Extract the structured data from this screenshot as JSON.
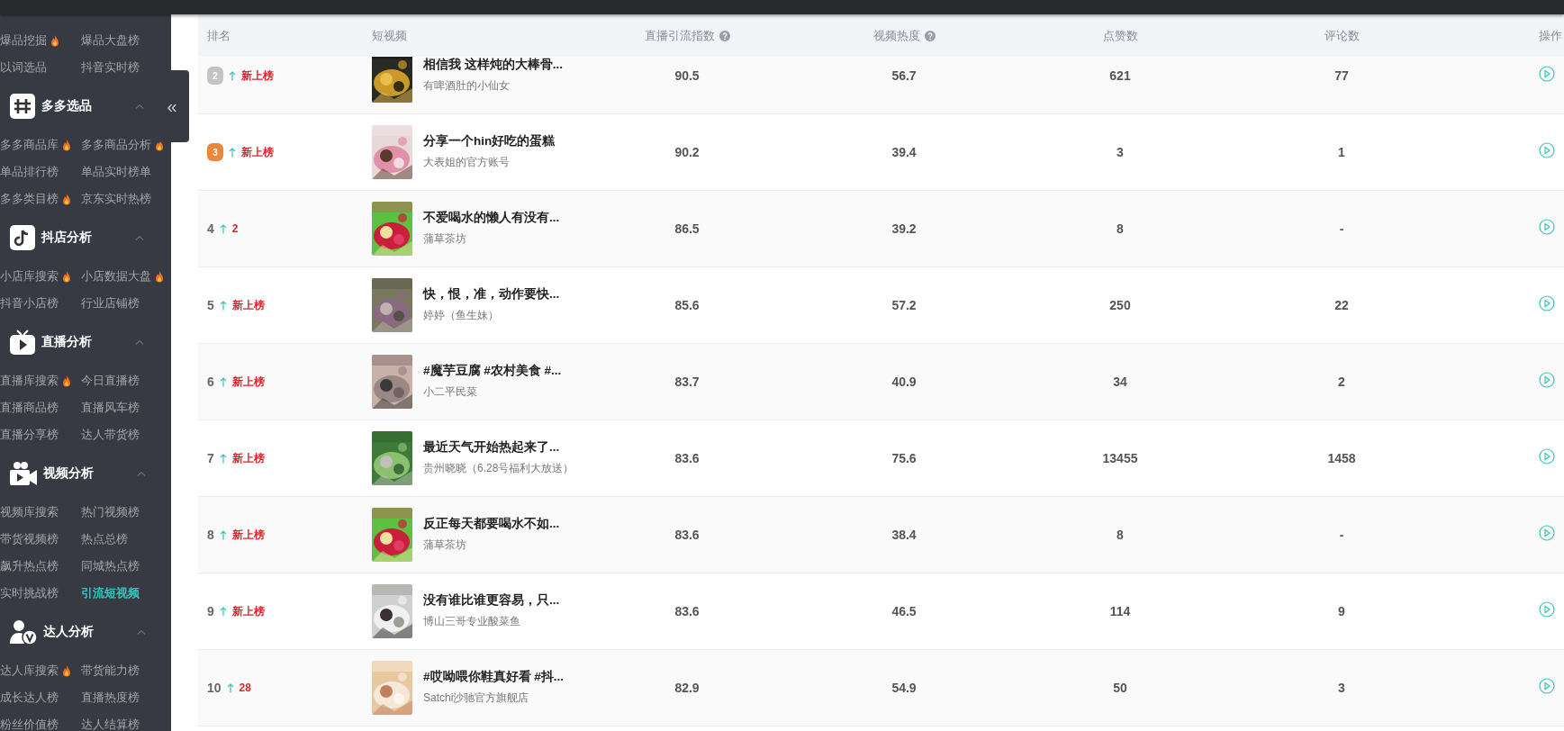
{
  "sidebar": {
    "groups": [
      {
        "items": [
          [
            {
              "label": "爆品挖掘",
              "hot": true,
              "selected": false
            },
            {
              "label": "爆品大盘榜",
              "hot": false,
              "selected": false
            }
          ],
          [
            {
              "label": "以词选品",
              "hot": false,
              "selected": false
            },
            {
              "label": "抖音实时榜",
              "hot": false,
              "selected": false
            }
          ]
        ]
      },
      {
        "title": "多多选品",
        "kind": "grid",
        "expanded": true,
        "items": [
          [
            {
              "label": "多多商品库",
              "hot": true,
              "selected": false
            },
            {
              "label": "多多商品分析",
              "hot": true,
              "selected": false
            }
          ],
          [
            {
              "label": "单品排行榜",
              "hot": false,
              "selected": false
            },
            {
              "label": "单品实时榜单",
              "hot": false,
              "selected": false
            }
          ],
          [
            {
              "label": "多多类目榜",
              "hot": true,
              "selected": false
            },
            {
              "label": "京东实时热榜",
              "hot": false,
              "selected": false
            }
          ]
        ]
      },
      {
        "title": "抖店分析",
        "kind": "note",
        "expanded": true,
        "items": [
          [
            {
              "label": "小店库搜索",
              "hot": true,
              "selected": false
            },
            {
              "label": "小店数据大盘",
              "hot": true,
              "selected": false
            }
          ],
          [
            {
              "label": "抖音小店榜",
              "hot": false,
              "selected": false
            },
            {
              "label": "行业店铺榜",
              "hot": false,
              "selected": false
            }
          ]
        ]
      },
      {
        "title": "直播分析",
        "kind": "tv",
        "expanded": true,
        "items": [
          [
            {
              "label": "直播库搜索",
              "hot": true,
              "selected": false
            },
            {
              "label": "今日直播榜",
              "hot": false,
              "selected": false
            }
          ],
          [
            {
              "label": "直播商品榜",
              "hot": false,
              "selected": false
            },
            {
              "label": "直播风车榜",
              "hot": false,
              "selected": false
            }
          ],
          [
            {
              "label": "直播分享榜",
              "hot": false,
              "selected": false
            },
            {
              "label": "达人带货榜",
              "hot": false,
              "selected": false
            }
          ]
        ]
      },
      {
        "title": "视频分析",
        "kind": "camera",
        "expanded": true,
        "items": [
          [
            {
              "label": "视频库搜索",
              "hot": false,
              "selected": false
            },
            {
              "label": "热门视频榜",
              "hot": false,
              "selected": false
            }
          ],
          [
            {
              "label": "带货视频榜",
              "hot": false,
              "selected": false
            },
            {
              "label": "热点总榜",
              "hot": false,
              "selected": false
            }
          ],
          [
            {
              "label": "飙升热点榜",
              "hot": false,
              "selected": false
            },
            {
              "label": "同城热点榜",
              "hot": false,
              "selected": false
            }
          ],
          [
            {
              "label": "实时挑战榜",
              "hot": false,
              "selected": false
            },
            {
              "label": "引流短视频",
              "hot": false,
              "selected": true
            }
          ]
        ]
      },
      {
        "title": "达人分析",
        "kind": "person",
        "expanded": true,
        "items": [
          [
            {
              "label": "达人库搜索",
              "hot": true,
              "selected": false
            },
            {
              "label": "带货能力榜",
              "hot": false,
              "selected": false
            }
          ],
          [
            {
              "label": "成长达人榜",
              "hot": false,
              "selected": false
            },
            {
              "label": "直播热度榜",
              "hot": false,
              "selected": false
            }
          ],
          [
            {
              "label": "粉丝价值榜",
              "hot": false,
              "selected": false
            },
            {
              "label": "达人结算榜",
              "hot": false,
              "selected": false
            }
          ]
        ]
      }
    ]
  },
  "collapse_button": "«",
  "table": {
    "columns": [
      {
        "label": "排名"
      },
      {
        "label": "短视频"
      },
      {
        "label": "直播引流指数",
        "help": true
      },
      {
        "label": "视频热度",
        "help": true
      },
      {
        "label": "点赞数"
      },
      {
        "label": "评论数"
      },
      {
        "label": "操作"
      }
    ],
    "rows": [
      {
        "rank": "2",
        "kind": "medal",
        "color": "#c4c4c4",
        "rising": true,
        "change": "新上榜",
        "title": "相信我 这样炖的大棒骨...",
        "author": "有啤酒肚的小仙女",
        "index": "90.5",
        "heat": "56.7",
        "likes": "621",
        "comments": "77"
      },
      {
        "rank": "3",
        "kind": "medal",
        "color": "#e9873a",
        "rising": true,
        "change": "新上榜",
        "title": "分享一个hin好吃的蛋糕",
        "author": "大表姐的官方账号",
        "index": "90.2",
        "heat": "39.4",
        "likes": "3",
        "comments": "1"
      },
      {
        "rank": "4",
        "kind": "plain",
        "rising": true,
        "change": "2",
        "title": "不爱喝水的懒人有没有...",
        "author": "蒲草茶坊",
        "index": "86.5",
        "heat": "39.2",
        "likes": "8",
        "comments": "-"
      },
      {
        "rank": "5",
        "kind": "plain",
        "rising": true,
        "change": "新上榜",
        "title": "快，恨，准，动作要快...",
        "author": "婷婷（鱼生妹）",
        "index": "85.6",
        "heat": "57.2",
        "likes": "250",
        "comments": "22"
      },
      {
        "rank": "6",
        "kind": "plain",
        "rising": true,
        "change": "新上榜",
        "title": "#魔芋豆腐 #农村美食 #...",
        "author": "小二平民菜",
        "index": "83.7",
        "heat": "40.9",
        "likes": "34",
        "comments": "2"
      },
      {
        "rank": "7",
        "kind": "plain",
        "rising": true,
        "change": "新上榜",
        "title": "最近天气开始热起来了...",
        "author": "贵州晓晓（6.28号福利大放送）",
        "index": "83.6",
        "heat": "75.6",
        "likes": "13455",
        "comments": "1458"
      },
      {
        "rank": "8",
        "kind": "plain",
        "rising": true,
        "change": "新上榜",
        "title": "反正每天都要喝水不如...",
        "author": "蒲草茶坊",
        "index": "83.6",
        "heat": "38.4",
        "likes": "8",
        "comments": "-"
      },
      {
        "rank": "9",
        "kind": "plain",
        "rising": true,
        "change": "新上榜",
        "title": "没有谁比谁更容易，只...",
        "author": "博山三哥专业酸菜鱼",
        "index": "83.6",
        "heat": "46.5",
        "likes": "114",
        "comments": "9"
      },
      {
        "rank": "10",
        "kind": "plain",
        "rising": true,
        "change": "28",
        "title": "#哎呦喂你鞋真好看 #抖...",
        "author": "Satchi沙驰官方旗舰店",
        "index": "82.9",
        "heat": "54.9",
        "likes": "50",
        "comments": "3"
      }
    ]
  }
}
